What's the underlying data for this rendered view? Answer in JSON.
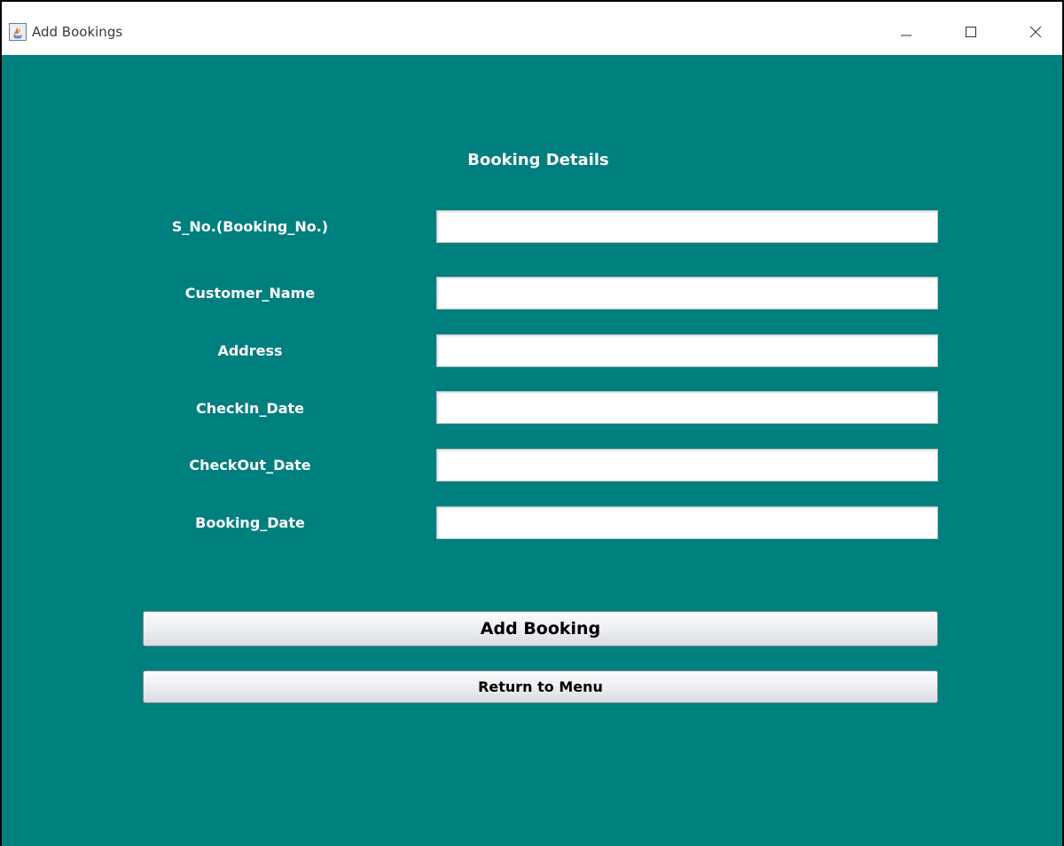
{
  "window": {
    "title": "Add Bookings",
    "app_icon": "java-icon",
    "controls": {
      "minimize_icon": "minimize-icon",
      "maximize_icon": "maximize-icon",
      "close_icon": "close-icon"
    }
  },
  "form": {
    "heading": "Booking Details",
    "background_color": "#007f7f",
    "fields": [
      {
        "label": "S_No.(Booking_No.)",
        "value": ""
      },
      {
        "label": "Customer_Name",
        "value": ""
      },
      {
        "label": "Address",
        "value": ""
      },
      {
        "label": "CheckIn_Date",
        "value": ""
      },
      {
        "label": "CheckOut_Date",
        "value": ""
      },
      {
        "label": "Booking_Date",
        "value": ""
      }
    ],
    "buttons": {
      "add_booking": "Add Booking",
      "return_to_menu": "Return to Menu"
    }
  }
}
